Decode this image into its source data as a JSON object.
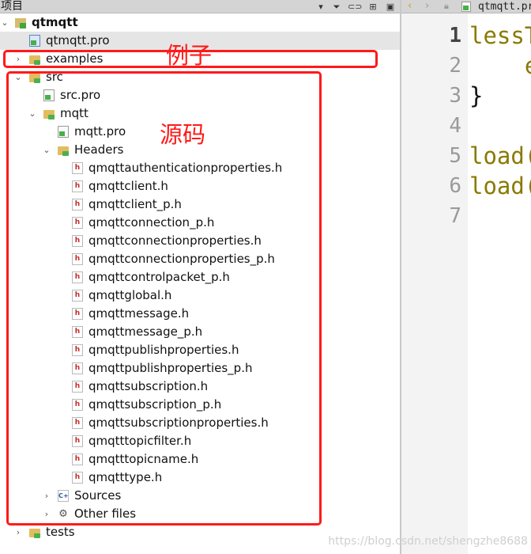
{
  "pane": {
    "title": "项目"
  },
  "toolbar_icons": [
    "chevron-down-icon",
    "filter-icon",
    "link-icon",
    "split-icon",
    "close-pane-icon"
  ],
  "tree": {
    "root": {
      "label": "qtmqtt",
      "icon": "qt-project-icon",
      "expanded": true
    },
    "items": [
      {
        "label": "qtmqtt.pro",
        "icon": "pro-file-icon",
        "selected": true
      },
      {
        "label": "examples",
        "icon": "folder-icon",
        "expanded": false
      },
      {
        "label": "src",
        "icon": "folder-icon",
        "expanded": true
      },
      {
        "label": "src.pro",
        "icon": "pro-file-icon"
      },
      {
        "label": "mqtt",
        "icon": "folder-icon",
        "expanded": true
      },
      {
        "label": "mqtt.pro",
        "icon": "pro-file-icon"
      },
      {
        "label": "Headers",
        "icon": "headers-folder-icon",
        "expanded": true
      },
      {
        "label": "Sources",
        "icon": "sources-folder-icon",
        "expanded": false
      },
      {
        "label": "Other files",
        "icon": "other-files-icon",
        "expanded": false
      },
      {
        "label": "tests",
        "icon": "folder-icon",
        "expanded": false
      }
    ],
    "headers": [
      "qmqttauthenticationproperties.h",
      "qmqttclient.h",
      "qmqttclient_p.h",
      "qmqttconnection_p.h",
      "qmqttconnectionproperties.h",
      "qmqttconnectionproperties_p.h",
      "qmqttcontrolpacket_p.h",
      "qmqttglobal.h",
      "qmqttmessage.h",
      "qmqttmessage_p.h",
      "qmqttpublishproperties.h",
      "qmqttpublishproperties_p.h",
      "qmqttsubscription.h",
      "qmqttsubscription_p.h",
      "qmqttsubscriptionproperties.h",
      "qmqtttopicfilter.h",
      "qmqtttopicname.h",
      "qmqtttype.h"
    ]
  },
  "annotations": {
    "examples_note": "例子",
    "src_note": "源码",
    "color": "#ff1a1a"
  },
  "editor": {
    "tab_label": "qtmqtt.pro",
    "line_numbers": [
      "1",
      "2",
      "3",
      "4",
      "5",
      "6",
      "7"
    ],
    "current_line": "1",
    "lines": [
      "lessT",
      "    e",
      "}",
      "",
      "load(",
      "load(",
      ""
    ]
  },
  "watermark": "https://blog.csdn.net/shengzhe8688"
}
